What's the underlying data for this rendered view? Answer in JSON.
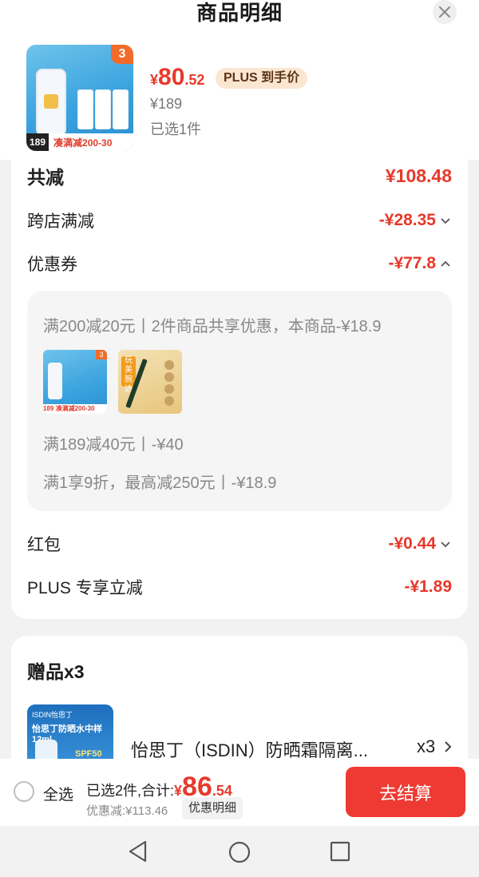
{
  "header": {
    "title": "商品明细"
  },
  "product": {
    "price_currency": "¥",
    "price_integer": "80",
    "price_decimal": ".52",
    "plus_tag": "PLUS 到手价",
    "original_price": "¥189",
    "selected_count": "已选1件",
    "thumb_badge": "3",
    "thumb_price": "189",
    "thumb_promo": "凑满减200-30"
  },
  "discounts": {
    "total_label": "共减",
    "total_value": "¥108.48",
    "rows": [
      {
        "label": "跨店满减",
        "value": "-¥28.35"
      },
      {
        "label": "优惠券",
        "value": "-¥77.8"
      },
      {
        "label": "红包",
        "value": "-¥0.44"
      },
      {
        "label": "PLUS 专享立减",
        "value": "-¥1.89"
      }
    ],
    "coupons": [
      "满200减20元丨2件商品共享优惠，本商品-¥18.9",
      "满189减40元丨-¥40",
      "满1享9折，最高减250元丨-¥18.9"
    ],
    "coupon_items": [
      {
        "footer": "189 凑满减200-30",
        "badge": "3"
      },
      {
        "label": "玩美腕达"
      }
    ]
  },
  "gift": {
    "title": "赠品x3",
    "name": "怡思丁（ISDIN）防晒霜隔离...",
    "qty": "x3",
    "thumb_line1": "ISDIN怡思丁",
    "thumb_line2": "怡思丁防晒水中样12ml",
    "thumb_line3": "SPF50"
  },
  "footer": {
    "select_all": "全选",
    "sum_prefix": "已选2件,合计:",
    "sum_currency": "¥",
    "sum_integer": "86",
    "sum_decimal": ".54",
    "discount_line": "优惠减:¥113.46",
    "detail_button": "优惠明细",
    "checkout_button": "去结算"
  },
  "colors": {
    "accent": "#e7392b",
    "checkout": "#ee3a32",
    "plus_bg": "#fbe6d2"
  }
}
